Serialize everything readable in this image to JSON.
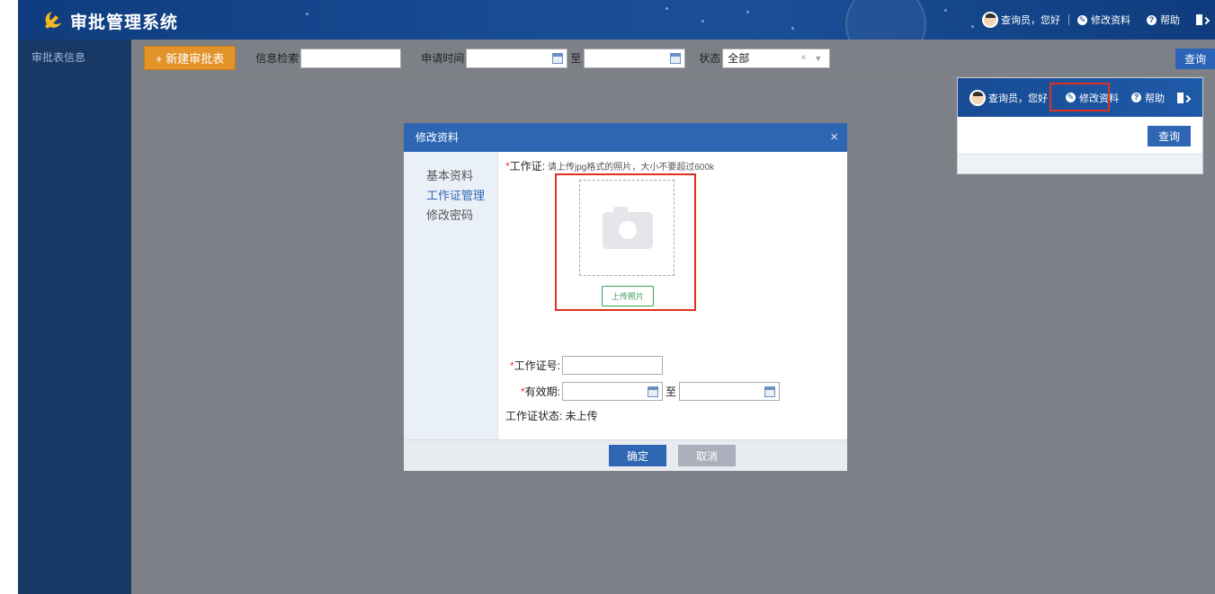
{
  "app": {
    "title": "审批管理系统"
  },
  "header": {
    "user_greeting": "查询员，您好",
    "edit_profile": "修改资料",
    "help": "帮助"
  },
  "sidebar": {
    "items": [
      {
        "label": "审批表信息"
      }
    ]
  },
  "toolbar": {
    "new_button": "+ 新建审批表",
    "search_label": "信息检索",
    "search_value": "",
    "time_label": "申请时间",
    "to_label": "至",
    "status_label": "状态",
    "status_value": "全部",
    "clear_symbol": "×",
    "dropdown_symbol": "▼",
    "query_button": "查询"
  },
  "modal": {
    "title": "修改资料",
    "close_symbol": "×",
    "nav": [
      {
        "label": "基本资料",
        "active": false
      },
      {
        "label": "工作证管理",
        "active": true
      },
      {
        "label": "修改密码",
        "active": false
      }
    ],
    "required_mark": "*",
    "photo_label": "工作证:",
    "photo_hint": "请上传jpg格式的照片，大小不要超过600k",
    "upload_button": "上传照片",
    "id_label": "工作证号:",
    "id_value": "",
    "validity_label": "有效期:",
    "validity_to": "至",
    "status_text": "工作证状态: 未上传",
    "ok_button": "确定",
    "cancel_button": "取消"
  },
  "popover": {
    "user_greeting": "查询员，您好",
    "edit_profile": "修改资料",
    "help": "帮助",
    "query_button": "查询"
  },
  "colors": {
    "header_blue": "#174b94",
    "sidebar": "#183866",
    "accent_orange": "#e2942b",
    "primary_button": "#2f66b3",
    "highlight_red": "#e0301e",
    "upload_green": "#3b9f5c"
  }
}
